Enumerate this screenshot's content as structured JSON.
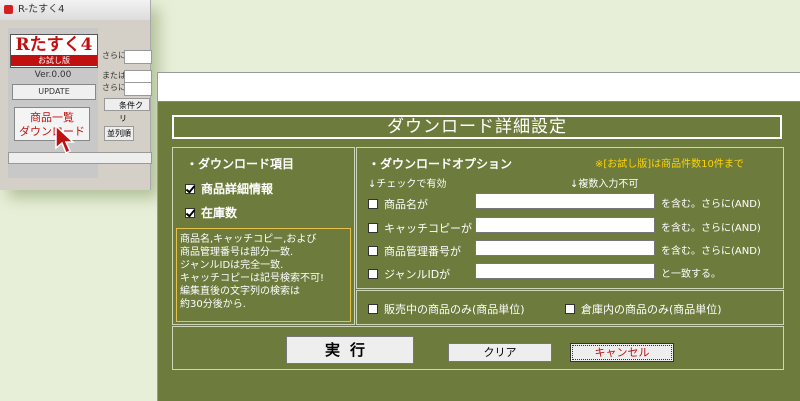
{
  "bg_app": {
    "title": "R-たすく4",
    "logo_main": "Rたすく4",
    "logo_sub": "お試し版",
    "version": "Ver.0.00",
    "update": "UPDATE",
    "list_button": "商品一覧\nダウンロード",
    "labels": [
      "さらに",
      "または",
      "さらに"
    ],
    "cond_button": "条件クリ",
    "sort_label": "並列順"
  },
  "dialog": {
    "title": "ダウンロード詳細設定",
    "left": {
      "section_title": "・ダウンロード項目",
      "items": [
        {
          "label": "商品詳細情報",
          "checked": true
        },
        {
          "label": "在庫数",
          "checked": true
        }
      ],
      "info": "商品名,キャッチコピー,および\n商品管理番号は部分一致.\nジャンルIDは完全一致.\nキャッチコピーは記号検索不可!\n編集直後の文字列の検索は\n約30分後から."
    },
    "right": {
      "section_title": "・ダウンロードオプション",
      "trial_note": "※[お試し版]は商品件数10件まで",
      "hint_check": "↓チェックで有効",
      "hint_multi": "↓複数入力不可",
      "options": [
        {
          "label": "商品名が",
          "value": "",
          "suffix": "を含む。さらに(AND)",
          "checked": false
        },
        {
          "label": "キャッチコピーが",
          "value": "",
          "suffix": "を含む。さらに(AND)",
          "checked": false
        },
        {
          "label": "商品管理番号が",
          "value": "",
          "suffix": "を含む。さらに(AND)",
          "checked": false
        },
        {
          "label": "ジャンルIDが",
          "value": "",
          "suffix": "と一致する。",
          "checked": false
        }
      ]
    },
    "filters": [
      {
        "label": "販売中の商品のみ(商品単位)",
        "checked": false
      },
      {
        "label": "倉庫内の商品のみ(商品単位)",
        "checked": false
      }
    ],
    "buttons": {
      "execute": "実行",
      "clear": "クリア",
      "cancel": "キャンセル"
    }
  }
}
